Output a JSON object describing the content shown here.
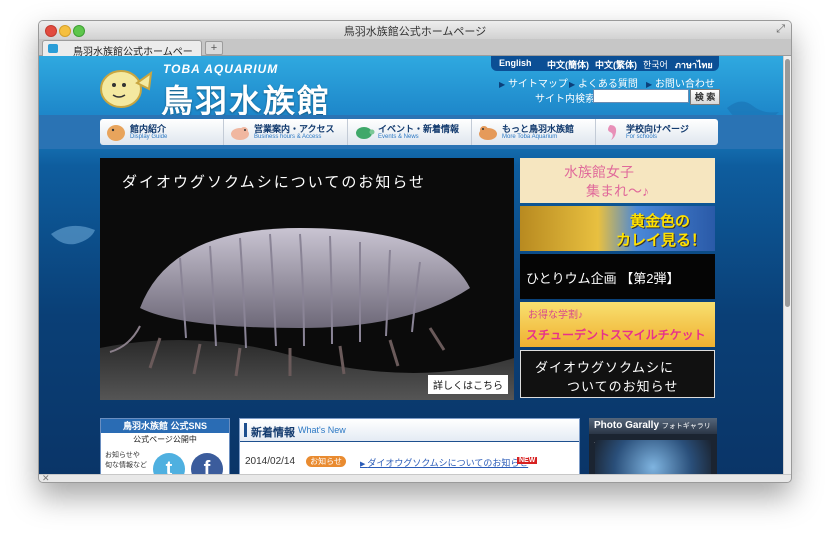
{
  "window": {
    "title": "鳥羽水族館公式ホームページ",
    "tab_label": "鳥羽水族館公式ホームページ",
    "newtab_label": "+"
  },
  "header": {
    "logo_sub": "TOBA AQUARIUM",
    "logo_main": "鳥羽水族館",
    "languages": [
      "English",
      "中文(簡体)",
      "中文(繁体)",
      "한국어",
      "ภาษาไทย"
    ],
    "util_links": [
      "サイトマップ",
      "よくある質問",
      "お問い合わせ"
    ],
    "search_label": "サイト内検索",
    "search_button": "検 索"
  },
  "nav": [
    {
      "label": "館内紹介",
      "sub": "Display Guide",
      "icon": "walrus-icon"
    },
    {
      "label": "営業案内・アクセス",
      "sub": "Business hours & Access",
      "icon": "seal-icon"
    },
    {
      "label": "イベント・新着情報",
      "sub": "Events & News",
      "icon": "turtle-icon"
    },
    {
      "label": "もっと鳥羽水族館",
      "sub": "More Toba  Aquarium",
      "icon": "sealion-icon"
    },
    {
      "label": "学校向けページ",
      "sub": "For schools",
      "icon": "seahorse-icon"
    }
  ],
  "hero": {
    "title": "ダイオウグソクムシについてのお知らせ",
    "more_label": "詳しくはこちら"
  },
  "banners": [
    {
      "line1": "水族館女子",
      "line2": "集まれ〜♪"
    },
    {
      "line1": "黄金色の",
      "line2": "カレイ見る！"
    },
    {
      "line1": "ひとりウム企画 【第2弾】"
    },
    {
      "line1": "お得な学割♪",
      "line2": "スチューデントスマイルチケット"
    },
    {
      "line1": "ダイオウグソクムシに",
      "line2": "ついてのお知らせ"
    }
  ],
  "sns": {
    "head": "鳥羽水族館 公式SNS",
    "sub": "公式ページ公開中",
    "text1": "お知らせや",
    "text2": "旬な情報など",
    "twitter_glyph": "t",
    "facebook_glyph": "f"
  },
  "news": {
    "title": "新着情報",
    "title_en": "What's New",
    "items": [
      {
        "date": "2014/02/14",
        "category": "お知らせ",
        "text": "ダイオウグソクムシについてのお知らせ",
        "new_label": "NEW"
      }
    ]
  },
  "gallery": {
    "title": "Photo Garally",
    "title_jp": "フォトギャラリー"
  },
  "colors": {
    "accent": "#0b4f95",
    "nav_text": "#123a6e",
    "badge": "#e98b30",
    "new_badge": "#d72020"
  }
}
